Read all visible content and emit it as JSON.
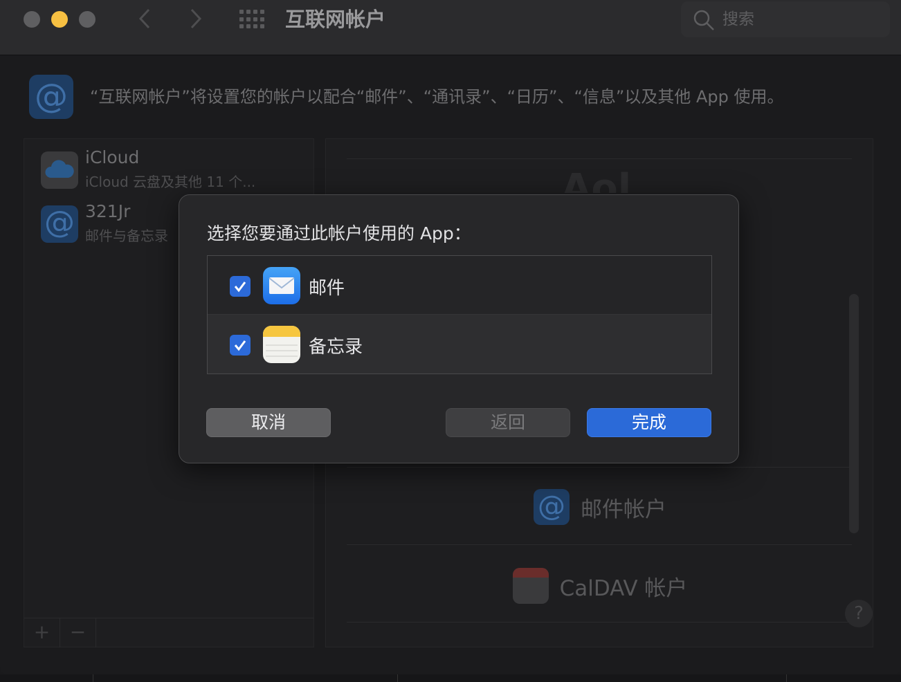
{
  "window": {
    "title": "互联网帐户",
    "traffic_colors": {
      "close": "#5f5f61",
      "minimize": "#f7c042",
      "maximize": "#5f5f61"
    }
  },
  "toolbar": {
    "back_icon": "chevron-left-icon",
    "forward_icon": "chevron-right-icon",
    "grid_icon": "show-all-grid-icon"
  },
  "search": {
    "placeholder": "搜索"
  },
  "header": {
    "description": "“互联网帐户”将设置您的帐户以配合“邮件”、“通讯录”、“日历”、“信息”以及其他 App 使用。"
  },
  "accounts": [
    {
      "name": "iCloud",
      "subtitle": "iCloud 云盘及其他 11 个...",
      "icon": "icloud-icon"
    },
    {
      "name": "321Jr",
      "subtitle": "邮件与备忘录",
      "icon": "at-sign-icon"
    }
  ],
  "account_toolbar": {
    "add_label": "+",
    "remove_label": "−"
  },
  "providers": {
    "partial_label": "Aol",
    "items": [
      {
        "label": "邮件帐户",
        "icon": "at-sign-icon"
      },
      {
        "label": "CalDAV 帐户",
        "icon": "calendar-icon"
      }
    ],
    "help_label": "?"
  },
  "dialog": {
    "title": "选择您要通过此帐户使用的 App：",
    "apps": [
      {
        "label": "邮件",
        "checked": true,
        "icon": "mail-app-icon"
      },
      {
        "label": "备忘录",
        "checked": true,
        "icon": "notes-app-icon"
      }
    ],
    "buttons": {
      "cancel": "取消",
      "back": "返回",
      "done": "完成"
    },
    "accent_color": "#2b6ad8"
  }
}
